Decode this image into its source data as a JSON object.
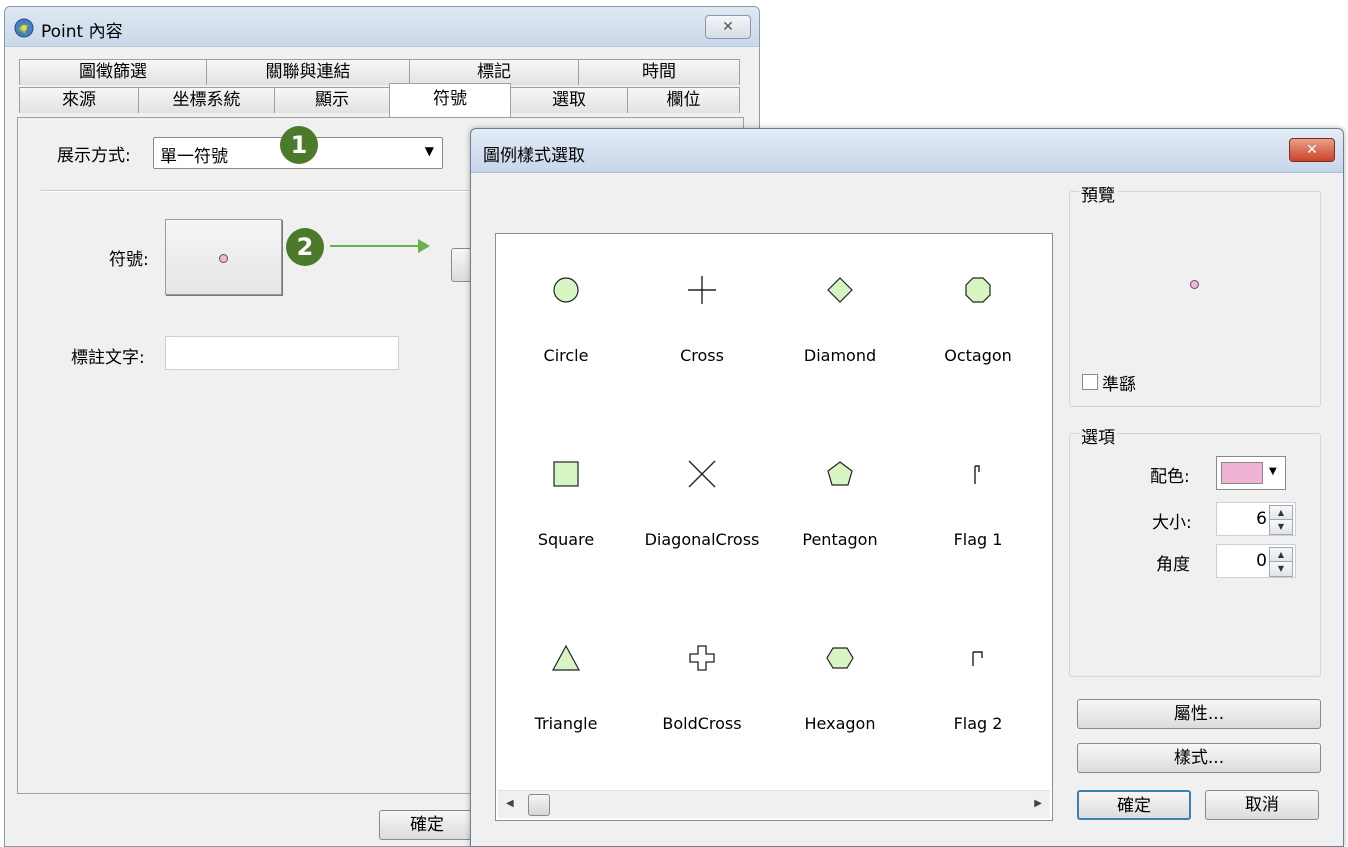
{
  "main_window": {
    "title": "Point  內容",
    "close_label": "✕",
    "tabs_row1": [
      "圖徵篩選",
      "關聯與連結",
      "標記",
      "時間"
    ],
    "tabs_row2": [
      "來源",
      "坐標系統",
      "顯示",
      "符號",
      "選取",
      "欄位"
    ],
    "active_tab": "符號",
    "display_mode_label": "展示方式:",
    "display_mode_value": "單一符號",
    "symbol_label": "符號:",
    "label_text_label": "標註文字:",
    "label_text_value": "",
    "ok_label": "確定"
  },
  "annotations": {
    "badge1": "1",
    "badge2": "2"
  },
  "dialog": {
    "title": "圖例樣式選取",
    "close_label": "✕",
    "symbols": [
      {
        "name": "Circle",
        "icon": "circle"
      },
      {
        "name": "Cross",
        "icon": "cross"
      },
      {
        "name": "Diamond",
        "icon": "diamond"
      },
      {
        "name": "Octagon",
        "icon": "octagon"
      },
      {
        "name": "Square",
        "icon": "square"
      },
      {
        "name": "DiagonalCross",
        "icon": "diagonal-cross"
      },
      {
        "name": "Pentagon",
        "icon": "pentagon"
      },
      {
        "name": "Flag 1",
        "icon": "flag1"
      },
      {
        "name": "Triangle",
        "icon": "triangle"
      },
      {
        "name": "BoldCross",
        "icon": "bold-cross"
      },
      {
        "name": "Hexagon",
        "icon": "hexagon"
      },
      {
        "name": "Flag 2",
        "icon": "flag2"
      }
    ],
    "preview_title": "預覽",
    "antialias_label": "準繇",
    "options_title": "選項",
    "color_label": "配色:",
    "color_value": "#efb4d3",
    "size_label": "大小:",
    "size_value": "6",
    "angle_label": "角度",
    "angle_value": "0",
    "properties_button": "屬性...",
    "style_button": "樣式...",
    "ok_button": "確定",
    "cancel_button": "取消"
  },
  "colors": {
    "symbol_fill": "#d6f5c3",
    "accent_green": "#4b7b2a",
    "arrow_green": "#6ab04c"
  }
}
